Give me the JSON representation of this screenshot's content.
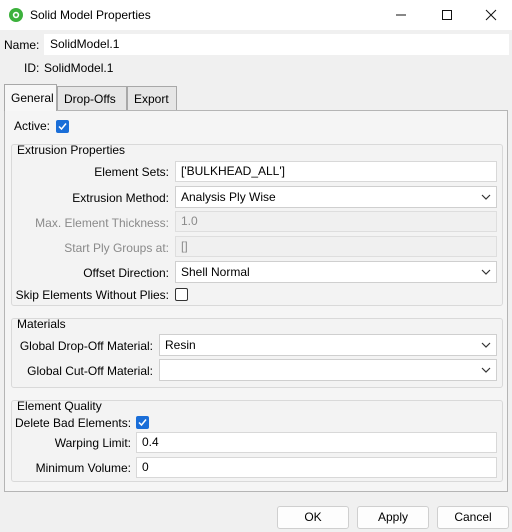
{
  "window": {
    "title": "Solid Model Properties",
    "icons": {
      "app": "gear-app-icon",
      "minimize": "minimize-icon",
      "maximize": "maximize-icon",
      "close": "close-icon"
    }
  },
  "header": {
    "name_label": "Name:",
    "name_value": "SolidModel.1",
    "id_label": "ID:",
    "id_value": "SolidModel.1"
  },
  "tabs": [
    {
      "label": "General",
      "active": true
    },
    {
      "label": "Drop-Offs",
      "active": false
    },
    {
      "label": "Export",
      "active": false
    }
  ],
  "general": {
    "active_label": "Active:",
    "active_checked": true,
    "extrusion": {
      "title": "Extrusion Properties",
      "element_sets_label": "Element Sets:",
      "element_sets_value": "['BULKHEAD_ALL']",
      "extrusion_method_label": "Extrusion Method:",
      "extrusion_method_value": "Analysis Ply Wise",
      "max_thickness_label": "Max. Element Thickness:",
      "max_thickness_value": "1.0",
      "start_ply_label": "Start Ply Groups at:",
      "start_ply_value": "[]",
      "offset_direction_label": "Offset Direction:",
      "offset_direction_value": "Shell Normal",
      "skip_elements_label": "Skip Elements Without Plies:",
      "skip_elements_checked": false
    },
    "materials": {
      "title": "Materials",
      "dropoff_label": "Global Drop-Off Material:",
      "dropoff_value": "Resin",
      "cutoff_label": "Global Cut-Off Material:",
      "cutoff_value": ""
    },
    "quality": {
      "title": "Element Quality",
      "delete_bad_label": "Delete Bad Elements:",
      "delete_bad_checked": true,
      "warping_label": "Warping Limit:",
      "warping_value": "0.4",
      "min_volume_label": "Minimum Volume:",
      "min_volume_value": "0"
    }
  },
  "buttons": {
    "ok": "OK",
    "apply": "Apply",
    "cancel": "Cancel"
  },
  "colors": {
    "accent": "#1a6ed8",
    "app_icon": "#3cb13c",
    "disabled_text": "#8a8a8a"
  }
}
